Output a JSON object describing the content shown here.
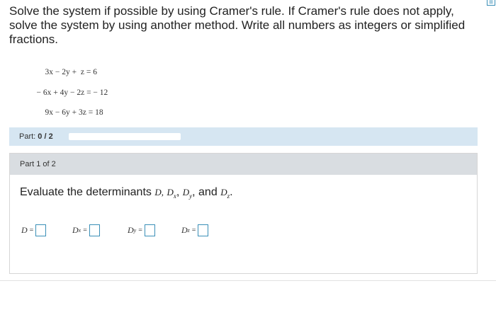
{
  "problem": {
    "text": "Solve the system if possible by using Cramer's rule. If Cramer's rule does not apply, solve the system by using another method. Write all numbers as integers or simplified fractions."
  },
  "equations": [
    {
      "lhs": "3x − 2y +  z",
      "rhs": "= 6"
    },
    {
      "lhs": "− 6x + 4y − 2z",
      "rhs": "= − 12"
    },
    {
      "lhs": "9x − 6y + 3z",
      "rhs": "= 18"
    }
  ],
  "part_bar": {
    "label_prefix": "Part: ",
    "label_value": "0 / 2",
    "progress_fraction": 0
  },
  "panel": {
    "title": "Part 1 of 2",
    "instruction_prefix": "Evaluate the determinants ",
    "instruction_suffix": "and",
    "determinants": [
      {
        "symbol": "D",
        "sub": "",
        "eq": "="
      },
      {
        "symbol": "D",
        "sub": "x",
        "eq": "="
      },
      {
        "symbol": "D",
        "sub": "y",
        "eq": "="
      },
      {
        "symbol": "D",
        "sub": "z",
        "eq": "="
      }
    ],
    "instruction_vars": [
      "D,",
      "D",
      "x",
      ",",
      "D",
      "y",
      ",",
      "D",
      "z",
      "."
    ]
  },
  "colors": {
    "accent": "#3a8fb7",
    "part_bar_bg": "#d6e6f2",
    "panel_header_bg": "#d9dde1"
  }
}
